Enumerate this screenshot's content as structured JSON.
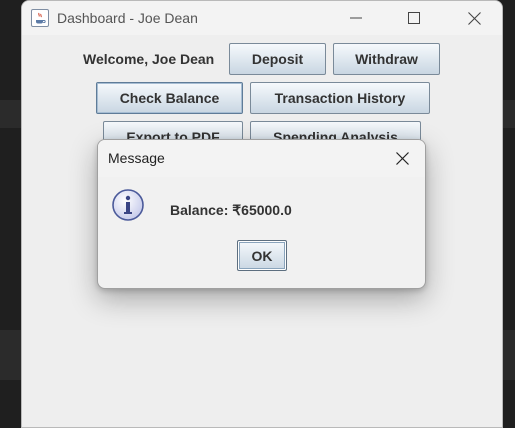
{
  "window": {
    "title": "Dashboard - Joe Dean",
    "icon": "java-icon"
  },
  "main": {
    "welcome": "Welcome, Joe Dean",
    "buttons": {
      "deposit": "Deposit",
      "withdraw": "Withdraw",
      "check_balance": "Check Balance",
      "transaction_history": "Transaction History",
      "export_pdf": "Export to PDF",
      "spending_analysis": "Spending Analysis"
    }
  },
  "dialog": {
    "title": "Message",
    "icon": "info-icon",
    "message": "Balance: ₹65000.0",
    "ok_label": "OK"
  },
  "colors": {
    "button_top": "#f6f9fc",
    "button_bottom": "#c9d6e2",
    "button_border": "#7a8a99",
    "info_icon_fill": "#d9dcf2",
    "info_icon_stroke": "#4b5a9a"
  }
}
